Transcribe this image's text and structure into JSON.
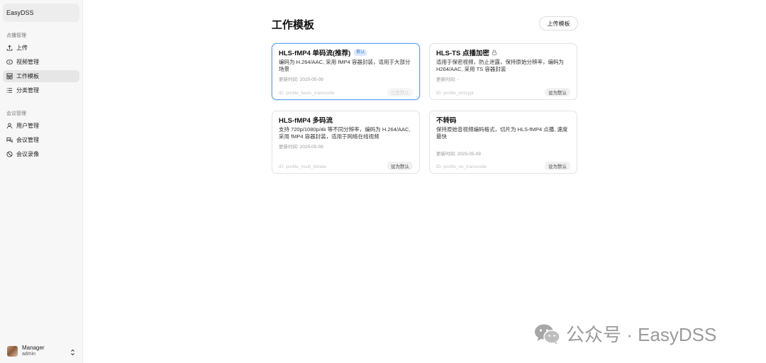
{
  "sidebar": {
    "brand": "EasyDSS",
    "groups": [
      {
        "label": "点播管理",
        "items": [
          {
            "label": "上传",
            "icon": "upload-icon"
          },
          {
            "label": "视频管理",
            "icon": "video-icon"
          },
          {
            "label": "工作模板",
            "icon": "template-icon",
            "active": true
          },
          {
            "label": "分类管理",
            "icon": "list-icon"
          }
        ]
      },
      {
        "label": "会议管理",
        "items": [
          {
            "label": "用户管理",
            "icon": "user-icon"
          },
          {
            "label": "会议管理",
            "icon": "meeting-icon"
          },
          {
            "label": "会议录像",
            "icon": "recording-icon"
          }
        ]
      }
    ],
    "user": {
      "name": "Manager",
      "role": "admin"
    }
  },
  "main": {
    "title": "工作模板",
    "upload_button": "上传模板",
    "cards": [
      {
        "title": "HLS-fMP4 单码流(推荐)",
        "badge": "默认",
        "desc": "编码为 H.264/AAC, 采用 fMP4 容器封装，适用于大部分场景",
        "updated": "更新时间: 2025-05-09",
        "id": "ID: profile_basic_transcode",
        "button": "已是默认",
        "selected": true
      },
      {
        "title": "HLS-TS 点播加密",
        "desc": "适用于保密视频，防止泄露，保持原始分辨率，编码为 H264/AAC, 采用 TS 容器封装",
        "updated": "更新时间: -",
        "id": "ID: profile_encrypt",
        "button": "设为默认"
      },
      {
        "title": "HLS-fMP4 多码流",
        "desc": "支持 720p/1080p/4k 等不同分辨率，编码为 H.264/AAC, 采用 fMP4 容器封装，适用于网络在线视频",
        "updated": "更新时间: 2025-05-09",
        "id": "ID: profile_multi_bitrate",
        "button": "设为默认"
      },
      {
        "title": "不转码",
        "desc": "保持原始音视频编码格式，切片为 HLS-fMP4 点播, 速度最快",
        "updated": "更新时间: 2025-05-09",
        "id": "ID: profile_no_transcode",
        "button": "设为默认"
      }
    ]
  },
  "watermark": "公众号 · EasyDSS",
  "colors": {
    "accent": "#5fa0f0",
    "badge_bg": "#dbe9ff",
    "badge_text": "#3a78d8",
    "sidebar_bg": "#f7f7f7"
  }
}
